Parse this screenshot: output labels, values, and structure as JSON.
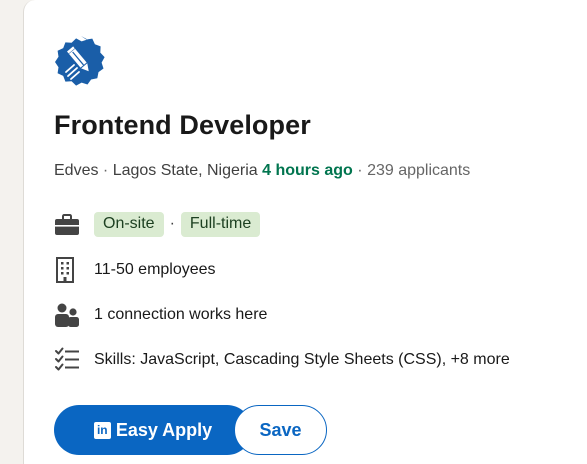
{
  "job": {
    "title": "Frontend Developer",
    "company": "Edves",
    "location": "Lagos State, Nigeria",
    "posted": "4 hours ago",
    "applicants": "239 applicants",
    "sep": "·"
  },
  "insights": {
    "workplace": "On-site",
    "job_type": "Full-time",
    "company_size": "11-50 employees",
    "connections": "1 connection works here",
    "skills": "Skills: JavaScript, Cascading Style Sheets (CSS), +8 more"
  },
  "actions": {
    "apply_label": "Easy Apply",
    "apply_icon": "in",
    "save_label": "Save"
  },
  "colors": {
    "accent": "#0a66c2",
    "posted_green": "#01754f",
    "pill_bg": "#daebd1",
    "logo_blue": "#1a5ea8"
  }
}
